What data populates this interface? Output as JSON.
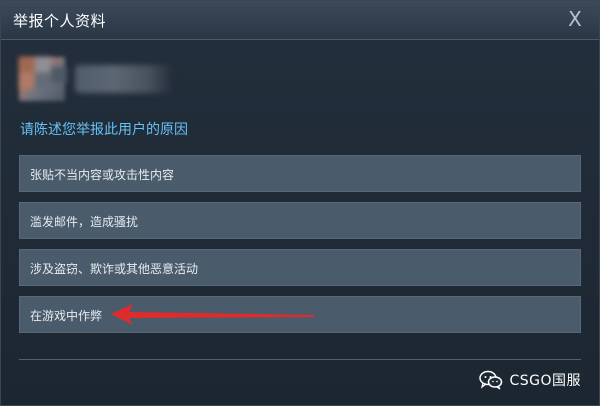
{
  "dialog": {
    "title": "举报个人资料",
    "close_label": "X",
    "prompt": "请陈述您举报此用户的原因",
    "options": [
      {
        "label": "张贴不当内容或攻击性内容"
      },
      {
        "label": "滥发邮件，造成骚扰"
      },
      {
        "label": "涉及盗窃、欺诈或其他恶意活动"
      },
      {
        "label": "在游戏中作弊"
      }
    ]
  },
  "annotation": {
    "arrow_color": "#e02b2b",
    "points_to": "在游戏中作弊"
  },
  "watermark": {
    "icon": "wechat-icon",
    "text": "CSGO国服"
  },
  "colors": {
    "accent": "#66c0f4",
    "option_bg": "#4a5b6c",
    "dialog_bg": "#1f2a36"
  }
}
